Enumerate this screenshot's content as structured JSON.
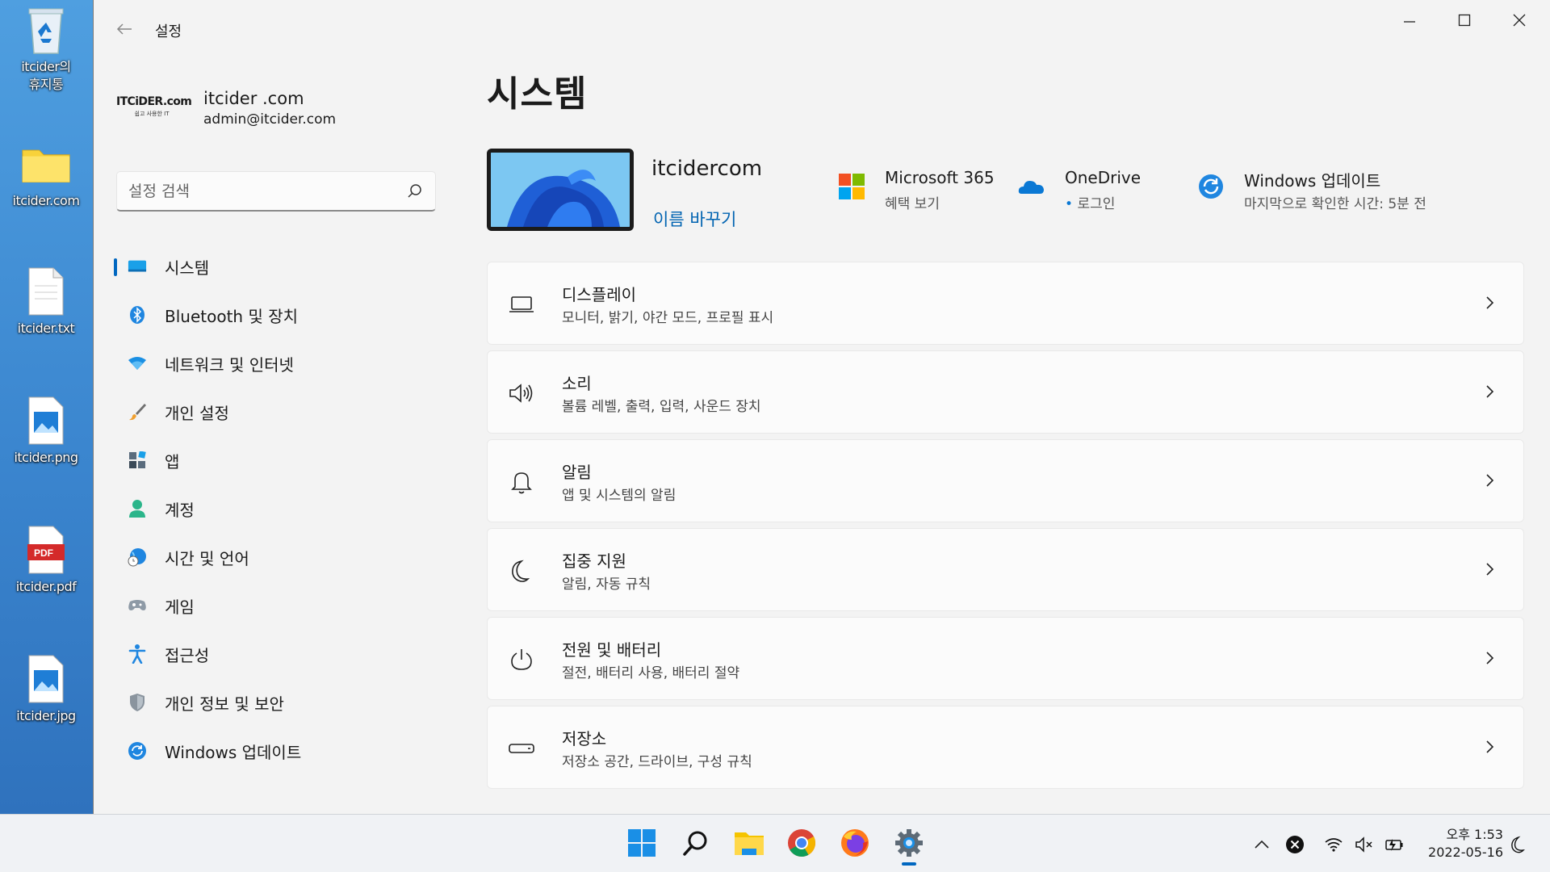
{
  "desktop": {
    "icons": [
      {
        "name": "itcider의\n휴지통",
        "icon": "recycle-bin-icon"
      },
      {
        "name": "itcider.com",
        "icon": "folder-icon"
      },
      {
        "name": "itcider.txt",
        "icon": "text-file-icon"
      },
      {
        "name": "itcider.png",
        "icon": "image-file-icon"
      },
      {
        "name": "itcider.pdf",
        "icon": "pdf-file-icon",
        "badge": "PDF"
      },
      {
        "name": "itcider.jpg",
        "icon": "image-file-icon"
      }
    ]
  },
  "window": {
    "title": "설정",
    "controls": [
      "minimize-icon",
      "maximize-icon",
      "close-icon"
    ]
  },
  "profile": {
    "logo_main": "ITCiDER.com",
    "logo_sub": "쉽고 사용한 IT",
    "name": "itcider .com",
    "email": "admin@itcider.com"
  },
  "search": {
    "placeholder": "설정 검색"
  },
  "nav": {
    "items": [
      {
        "label": "시스템",
        "icon": "system-icon",
        "selected": true
      },
      {
        "label": "Bluetooth 및 장치",
        "icon": "bluetooth-icon"
      },
      {
        "label": "네트워크 및 인터넷",
        "icon": "wifi-icon"
      },
      {
        "label": "개인 설정",
        "icon": "brush-icon"
      },
      {
        "label": "앱",
        "icon": "apps-icon"
      },
      {
        "label": "계정",
        "icon": "account-icon"
      },
      {
        "label": "시간 및 언어",
        "icon": "globe-clock-icon"
      },
      {
        "label": "게임",
        "icon": "gamepad-icon"
      },
      {
        "label": "접근성",
        "icon": "accessibility-icon"
      },
      {
        "label": "개인 정보 및 보안",
        "icon": "shield-icon"
      },
      {
        "label": "Windows 업데이트",
        "icon": "update-icon"
      }
    ]
  },
  "main": {
    "title": "시스템",
    "device": {
      "name": "itcidercom",
      "rename": "이름 바꾸기"
    },
    "quick_links": [
      {
        "title": "Microsoft 365",
        "subtitle": "혜택 보기",
        "icon": "microsoft-logo-icon"
      },
      {
        "title": "OneDrive",
        "subtitle": "로그인",
        "icon": "onedrive-cloud-icon"
      },
      {
        "title": "Windows 업데이트",
        "subtitle": "마지막으로 확인한 시간: 5분 전",
        "icon": "update-icon"
      }
    ],
    "cards": [
      {
        "title": "디스플레이",
        "subtitle": "모니터, 밝기, 야간 모드, 프로필 표시",
        "icon": "display-icon"
      },
      {
        "title": "소리",
        "subtitle": "볼륨 레벨, 출력, 입력, 사운드 장치",
        "icon": "speaker-icon"
      },
      {
        "title": "알림",
        "subtitle": "앱 및 시스템의 알림",
        "icon": "bell-icon"
      },
      {
        "title": "집중 지원",
        "subtitle": "알림, 자동 규칙",
        "icon": "moon-icon"
      },
      {
        "title": "전원 및 배터리",
        "subtitle": "절전, 배터리 사용, 배터리 절약",
        "icon": "power-icon"
      },
      {
        "title": "저장소",
        "subtitle": "저장소 공간, 드라이브, 구성 규칙",
        "icon": "storage-icon"
      }
    ]
  },
  "taskbar": {
    "apps": [
      "windows-start-icon",
      "search-icon",
      "file-explorer-icon",
      "chrome-icon",
      "firefox-icon",
      "settings-gear-icon"
    ],
    "tray": [
      "chevron-up-icon",
      "close-circle-icon",
      "wifi-icon",
      "speaker-muted-icon",
      "battery-charging-icon"
    ],
    "time": "오후 1:53",
    "date": "2022-05-16",
    "focus": "moon-icon"
  },
  "colors": {
    "accent": "#0067c0",
    "window_bg": "#f3f3f3",
    "card_bg": "#fbfbfb",
    "desktop_bg": "#3a8fd6"
  }
}
